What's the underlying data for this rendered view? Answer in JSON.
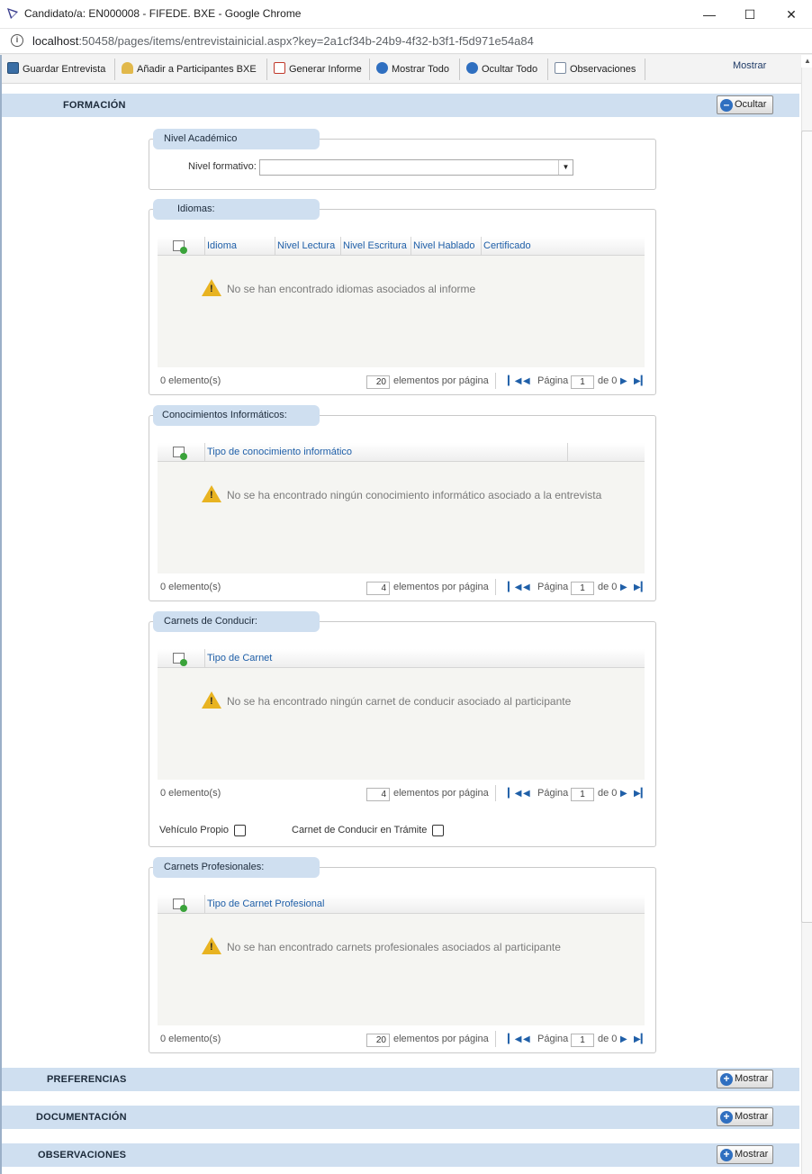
{
  "window": {
    "title": "Candidato/a: EN000008 - FIFEDE. BXE - Google Chrome",
    "url_host": "localhost",
    "url_path": ":50458/pages/items/entrevistainicial.aspx?key=2a1cf34b-24b9-4f32-b3f1-f5d971e54a84"
  },
  "toolbar": {
    "save": "Guardar Entrevista",
    "add_participants": "Añadir a Participantes BXE",
    "report": "Generar Informe",
    "show_all": "Mostrar Todo",
    "hide_all": "Ocultar Todo",
    "notes": "Observaciones",
    "show": "Mostrar"
  },
  "sections": {
    "formacion": {
      "title": "FORMACIÓN",
      "button": "Ocultar"
    },
    "preferencias": {
      "title": "PREFERENCIAS",
      "button": "Mostrar"
    },
    "documentacion": {
      "title": "DOCUMENTACIÓN",
      "button": "Mostrar"
    },
    "observaciones": {
      "title": "OBSERVACIONES",
      "button": "Mostrar"
    }
  },
  "nivel_academico": {
    "legend": "Nivel Académico",
    "label": "Nivel formativo:",
    "value": ""
  },
  "idiomas": {
    "legend": "Idiomas:",
    "columns": [
      "Idioma",
      "Nivel Lectura",
      "Nivel Escritura",
      "Nivel Hablado",
      "Certificado"
    ],
    "empty": "No se han encontrado idiomas asociados al informe",
    "count": "0 elemento(s)",
    "page_size": "20"
  },
  "informaticos": {
    "legend": "Conocimientos Informáticos:",
    "columns": [
      "Tipo de conocimiento informático"
    ],
    "empty": "No se ha encontrado ningún conocimiento informático asociado a la entrevista",
    "count": "0 elemento(s)",
    "page_size": "4"
  },
  "carnets": {
    "legend": "Carnets de Conducir:",
    "columns": [
      "Tipo de Carnet"
    ],
    "empty": "No se ha encontrado ningún carnet de conducir asociado al participante",
    "count": "0 elemento(s)",
    "page_size": "4",
    "vehiculo_label": "Vehículo Propio",
    "tramite_label": "Carnet de Conducir en Trámite"
  },
  "profesionales": {
    "legend": "Carnets Profesionales:",
    "columns": [
      "Tipo de Carnet Profesional"
    ],
    "empty": "No se han encontrado carnets profesionales asociados al participante",
    "count": "0 elemento(s)",
    "page_size": "20"
  },
  "pager": {
    "per_page": "elementos por página",
    "page": "Página",
    "current": "1",
    "of": "de 0"
  },
  "icons": {
    "warning": "warning-icon",
    "add": "add-row-icon",
    "first": "first-page-icon",
    "prev": "prev-page-icon",
    "next": "next-page-icon",
    "last": "last-page-icon"
  }
}
